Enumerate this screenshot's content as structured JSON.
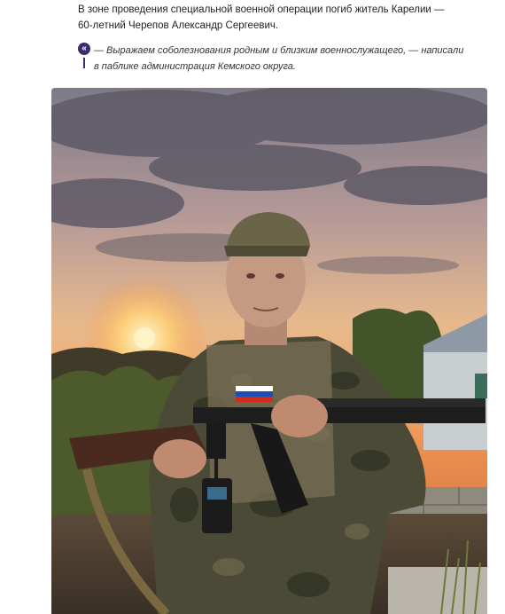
{
  "article": {
    "lead_text": "В зоне проведения специальной военной операции погиб житель Карелии — 60-летний Черепов Александр Сергеевич.",
    "quote_text": "— Выражаем соболезнования родным и близким военнослужащего, — написали в паблике администрация Кемского округа.",
    "quote_icon_glyph": "«"
  },
  "photo": {
    "flag_colors": [
      "#ffffff",
      "#1c4fb5",
      "#d52b1e"
    ]
  }
}
